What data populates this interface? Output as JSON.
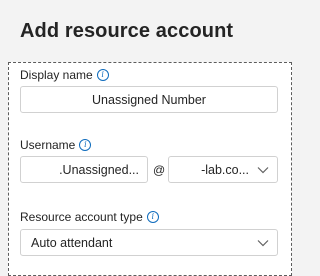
{
  "title": "Add resource account",
  "display_name": {
    "label": "Display name",
    "value": "Unassigned Number"
  },
  "username": {
    "label": "Username",
    "value": ".Unassigned...",
    "at": "@",
    "domain": "-lab.co..."
  },
  "resource_account_type": {
    "label": "Resource account type",
    "value": "Auto attendant"
  },
  "icons": {
    "info": "info-icon",
    "chevron": "chevron-down-icon"
  }
}
